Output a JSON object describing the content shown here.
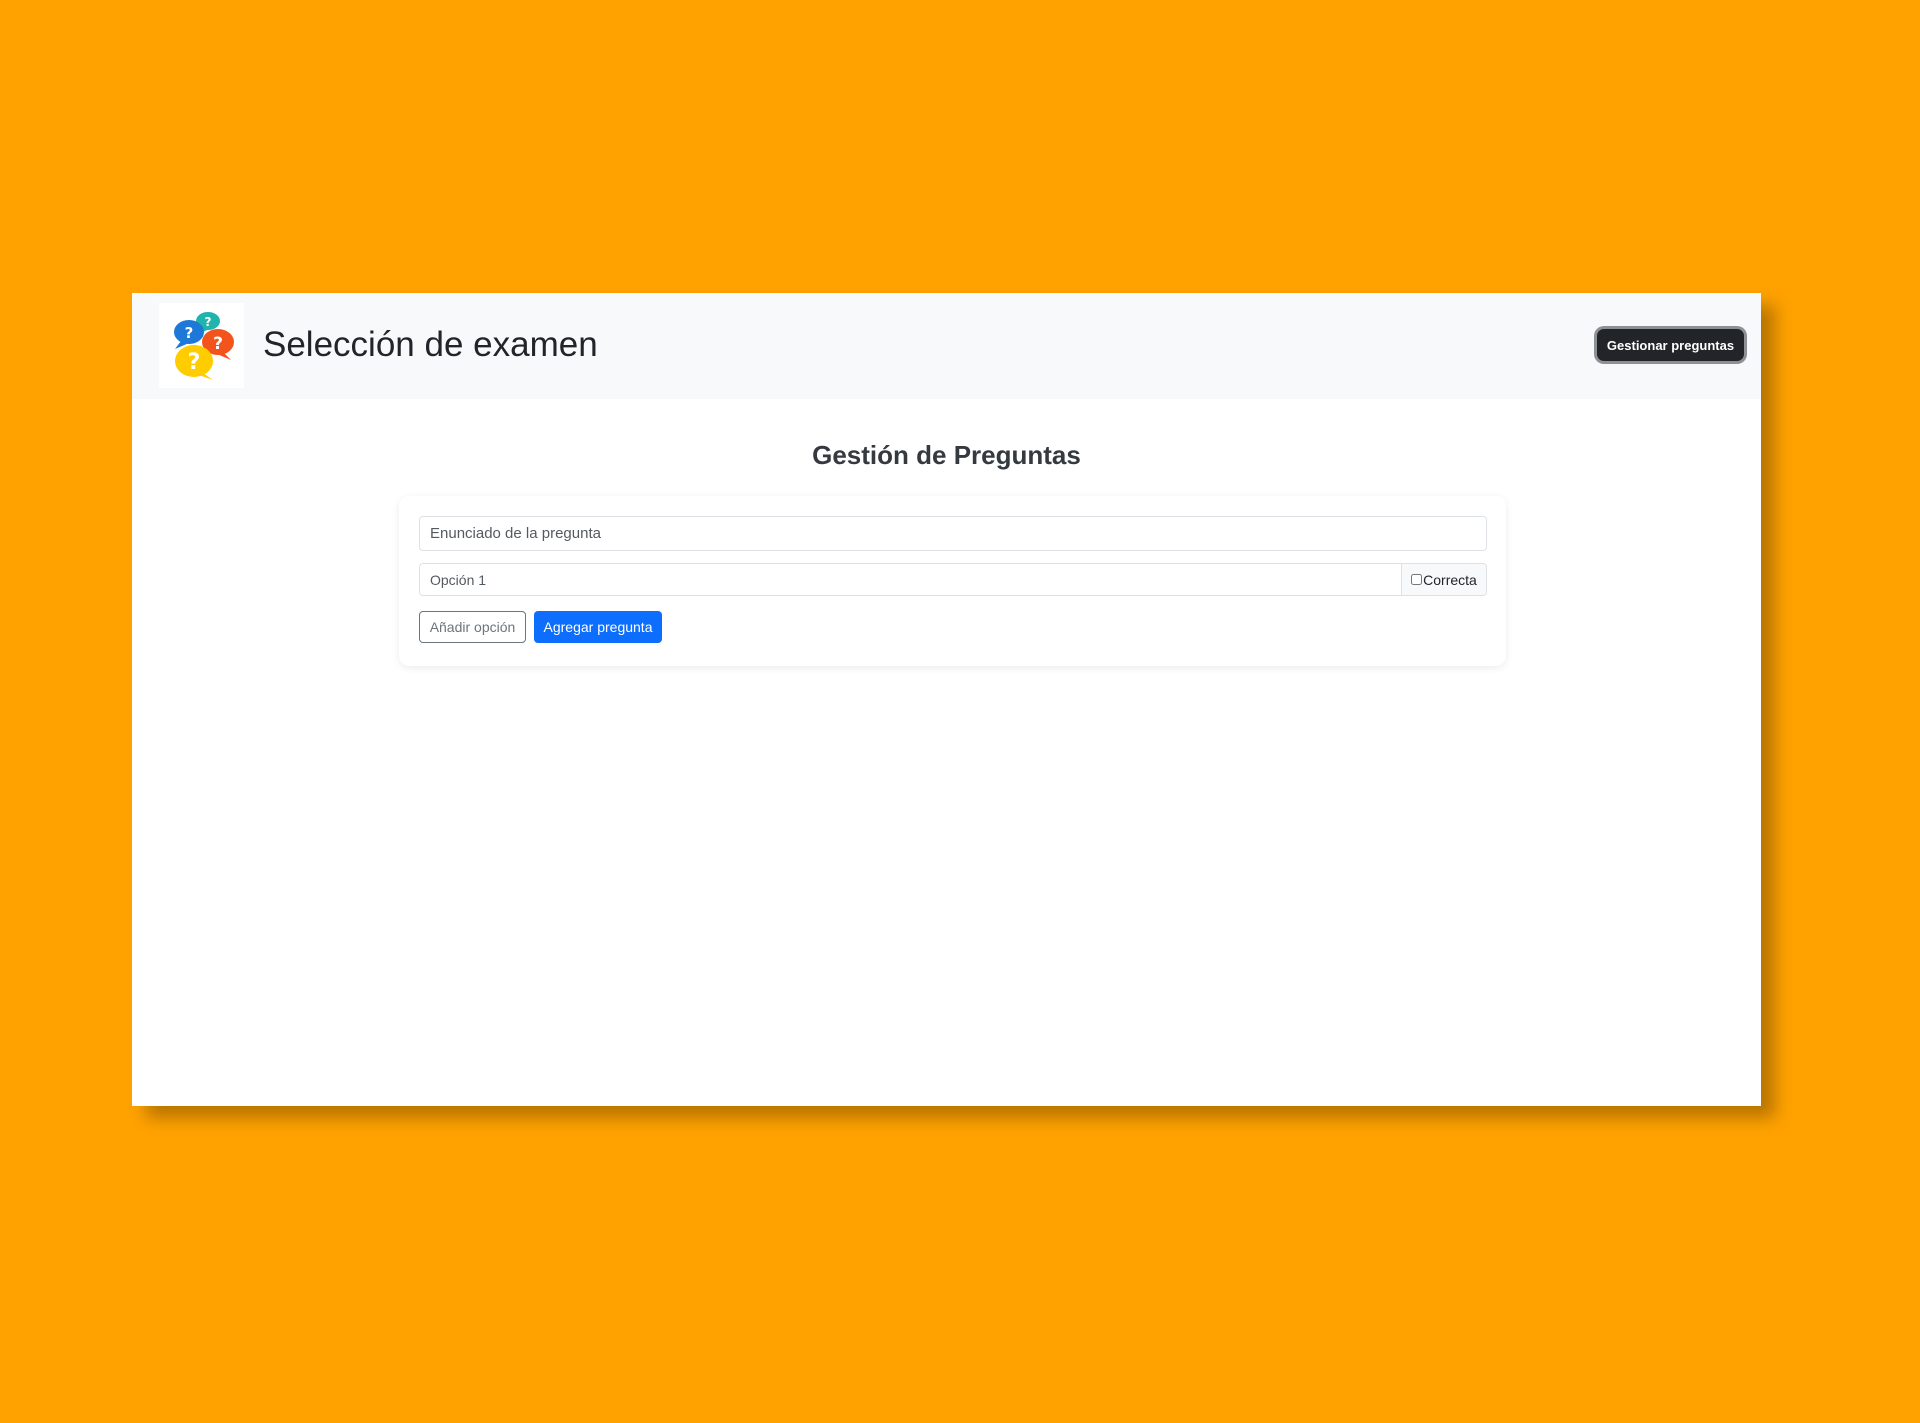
{
  "navbar": {
    "title": "Selección de examen",
    "manage_button_label": "Gestionar preguntas",
    "logo_icon": "question-bubbles-icon"
  },
  "main": {
    "heading": "Gestión de Preguntas",
    "question_input": {
      "placeholder": "Enunciado de la pregunta",
      "value": ""
    },
    "option_input": {
      "placeholder": "Opción 1",
      "value": ""
    },
    "correct_label": "Correcta",
    "add_option_label": "Añadir opción",
    "add_question_label": "Agregar pregunta"
  },
  "colors": {
    "background": "#ffa200",
    "primary": "#0d6efd",
    "dark": "#212529",
    "secondary": "#6c757d",
    "navbar_bg": "#f8f9fa"
  }
}
